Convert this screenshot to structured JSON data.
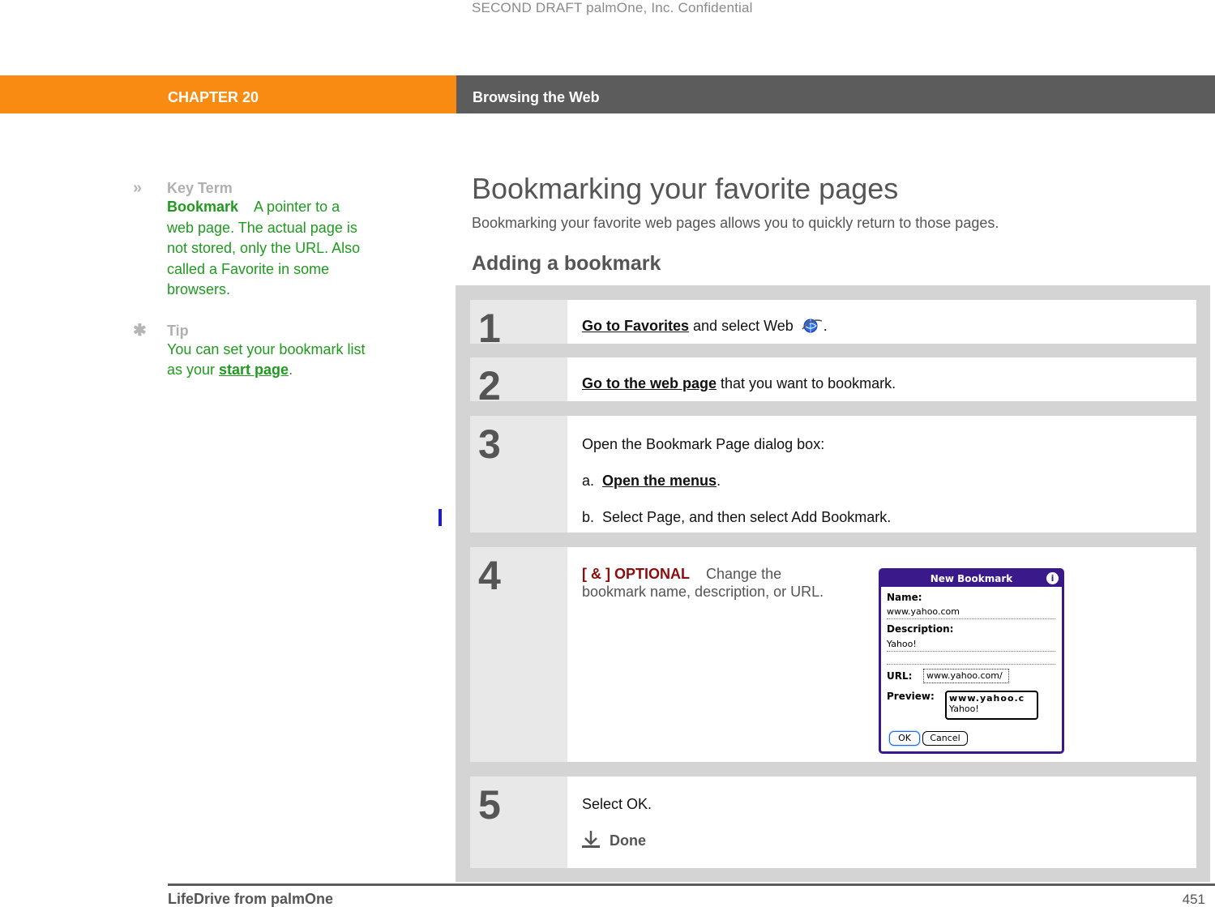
{
  "watermark": "SECOND DRAFT palmOne, Inc.  Confidential",
  "header": {
    "chapter": "CHAPTER 20",
    "title": "Browsing the Web",
    "colors": {
      "chapter_bg": "#f98b12",
      "title_bg": "#5c5c5c"
    }
  },
  "sidebar": {
    "key_term": {
      "icon": "double-chevron-right-icon",
      "heading": "Key Term",
      "term": "Bookmark",
      "definition": "A pointer to a web page. The actual page is not stored, only the URL. Also called a Favorite in some browsers."
    },
    "tip": {
      "icon": "asterisk-icon",
      "heading": "Tip",
      "text_before": "You can set your bookmark list as your ",
      "link": "start page",
      "text_after": "."
    }
  },
  "main": {
    "title": "Bookmarking your favorite pages",
    "intro": "Bookmarking your favorite web pages allows you to quickly return to those pages.",
    "section_title": "Adding a bookmark",
    "steps": [
      {
        "number": "1",
        "link": "Go to Favorites",
        "text": " and select Web",
        "icon": "web-globe-icon",
        "after": "."
      },
      {
        "number": "2",
        "link": "Go to the web page",
        "text": " that you want to bookmark."
      },
      {
        "number": "3",
        "text": "Open the Bookmark Page dialog box:",
        "substeps": [
          {
            "marker": "a.",
            "link": "Open the menus",
            "after": "."
          },
          {
            "marker": "b.",
            "text": "Select Page, and then select Add Bookmark."
          }
        ]
      },
      {
        "number": "4",
        "optional_label": "[ & ]  OPTIONAL",
        "text": "Change the bookmark name, description, or URL.",
        "dialog": {
          "title": "New Bookmark",
          "info_icon": "i",
          "name_label": "Name:",
          "name_value": "www.yahoo.com",
          "description_label": "Description:",
          "description_value": "Yahoo!",
          "url_label": "URL:",
          "url_value": "www.yahoo.com/",
          "preview_label": "Preview:",
          "preview_title": "www.yahoo.c",
          "preview_desc": "Yahoo!",
          "ok_label": "OK",
          "cancel_label": "Cancel"
        }
      },
      {
        "number": "5",
        "text": "Select OK.",
        "done_label": "Done"
      }
    ]
  },
  "footer": {
    "left": "LifeDrive from palmOne",
    "page_number": "451"
  }
}
